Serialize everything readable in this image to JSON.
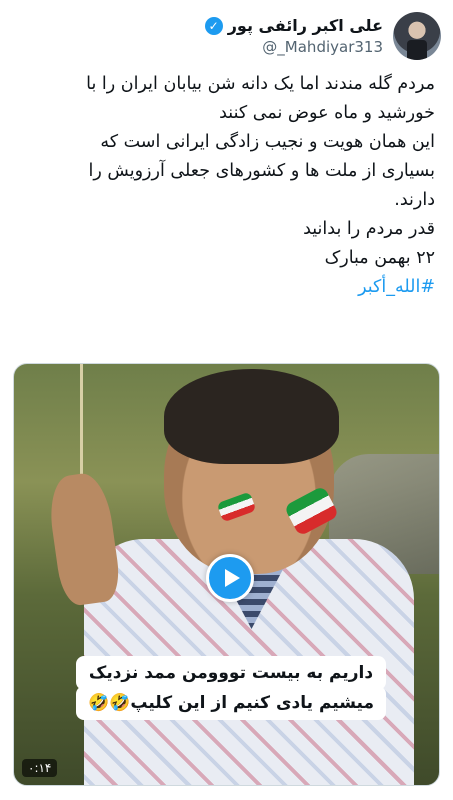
{
  "author": {
    "display_name": "علی اکبر رائفی پور",
    "handle": "@_Mahdiyar313",
    "verified_icon": "verified-badge-icon"
  },
  "tweet": {
    "lines": [
      "مردم گله مندند اما یک دانه شن بیابان ایران را با",
      "خورشید و ماه عوض نمی کنند",
      "این همان هویت و نجیب زادگی ایرانی است که",
      "بسیاری از ملت ها و کشورهای جعلی آرزویش را",
      "دارند.",
      "قدر مردم را بدانید",
      "۲۲ بهمن مبارک"
    ],
    "hashtag": "#الله_أكبر"
  },
  "media": {
    "caption_line1": "داریم به بیست تووومن ممد نزدیک",
    "caption_line2": "میشیم یادی کنیم از این کلیپ🤣🤣",
    "duration": "۰:۱۴",
    "play_icon": "play-icon"
  },
  "colors": {
    "accent": "#1d9bf0",
    "text": "#0f1419",
    "secondary": "#536471"
  }
}
